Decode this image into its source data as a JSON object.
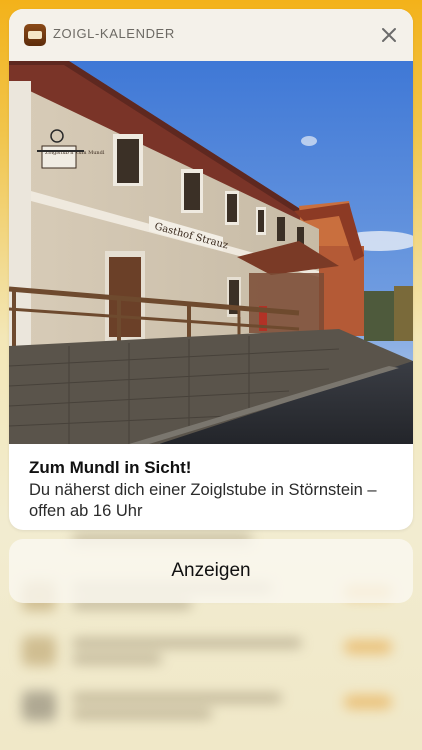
{
  "notification": {
    "app_name": "ZOIGL-KALENDER",
    "app_icon": "zoigl-kalender-app-icon",
    "close_icon": "close-icon",
    "image_sign_main": "Gasthof Strauz",
    "image_sign_small": "Zoiglstub'n Zum Mundl",
    "title": "Zum Mundl in Sicht!",
    "body": "Du näherst dich einer Zoiglstube in Störnstein – offen ab 16 Uhr"
  },
  "action": {
    "label": "Anzeigen"
  },
  "colors": {
    "background_top": "#f3b21a",
    "card": "#ffffff",
    "header": "#f4f1ea"
  }
}
